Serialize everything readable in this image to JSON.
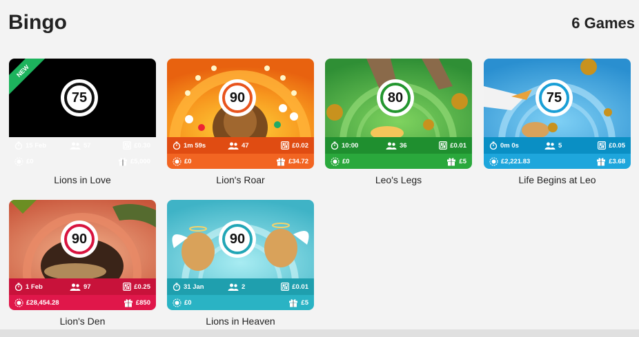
{
  "page": {
    "title": "Bingo",
    "games_count": "6 Games"
  },
  "games": [
    {
      "name": "Lions in Love",
      "ball": "75",
      "time": "15 Feb",
      "players": "57",
      "price": "£0.30",
      "jackpot": "£0",
      "prize": "£5,000",
      "badge": "NEW",
      "bar1_color": "#000000",
      "bar2_color": "#000000",
      "ring_color": "#111111"
    },
    {
      "name": "Lion's Roar",
      "ball": "90",
      "time": "1m 59s",
      "players": "47",
      "price": "£0.02",
      "jackpot": "£0",
      "prize": "£34.72",
      "bar1_color": "#e04c12",
      "bar2_color": "#f26522",
      "ring_color": "#e8541d"
    },
    {
      "name": "Leo's Legs",
      "ball": "80",
      "time": "10:00",
      "players": "36",
      "price": "£0.01",
      "jackpot": "£0",
      "prize": "£5",
      "bar1_color": "#1f8f2f",
      "bar2_color": "#2aa83c",
      "ring_color": "#23962f"
    },
    {
      "name": "Life Begins at Leo",
      "ball": "75",
      "time": "0m 0s",
      "players": "5",
      "price": "£0.05",
      "jackpot": "£2,221.83",
      "prize": "£3.68",
      "bar1_color": "#0a8fc4",
      "bar2_color": "#1ea6dc",
      "ring_color": "#1a9fd6"
    },
    {
      "name": "Lion's Den",
      "ball": "90",
      "time": "1 Feb",
      "players": "97",
      "price": "£0.25",
      "jackpot": "£28,454.28",
      "prize": "£850",
      "bar1_color": "#c8123a",
      "bar2_color": "#e0174a",
      "ring_color": "#d8143f"
    },
    {
      "name": "Lions in Heaven",
      "ball": "90",
      "time": "31 Jan",
      "players": "2",
      "price": "£0.01",
      "jackpot": "£0",
      "prize": "£5",
      "bar1_color": "#1f9fae",
      "bar2_color": "#2ab3c4",
      "ring_color": "#22a6b6"
    }
  ],
  "icons": {
    "time": "stopwatch-icon",
    "players": "players-icon",
    "price": "card-price-icon",
    "jackpot": "jackpot-icon",
    "prize": "gift-icon"
  }
}
